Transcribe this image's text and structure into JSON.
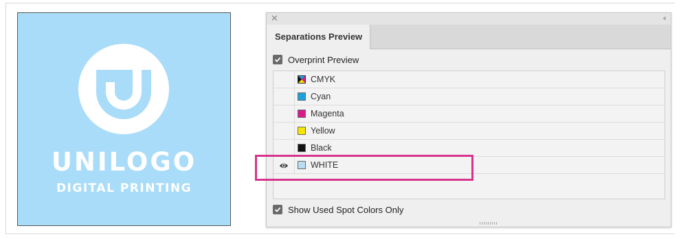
{
  "artwork": {
    "brand_name": "UNILOGO",
    "tagline": "DIGITAL PRINTING",
    "background_color": "#a9dcf8",
    "logo_icon": "u-circle-logo"
  },
  "panel": {
    "close_icon": "close-icon",
    "collapse_icon": "double-chevron-icon",
    "tab_label": "Separations Preview",
    "overprint_label": "Overprint Preview",
    "overprint_checked": true,
    "separations": [
      {
        "label": "CMYK",
        "color": "cmyk",
        "visible": false
      },
      {
        "label": "Cyan",
        "color": "#1da1dc",
        "visible": false
      },
      {
        "label": "Magenta",
        "color": "#d81b8a",
        "visible": false
      },
      {
        "label": "Yellow",
        "color": "#f6e500",
        "visible": false
      },
      {
        "label": "Black",
        "color": "#111111",
        "visible": false
      },
      {
        "label": "WHITE",
        "color": "#b9dcf3",
        "visible": true
      }
    ],
    "spot_only_label": "Show Used Spot Colors Only",
    "spot_only_checked": true
  },
  "highlight_color": "#d6338e"
}
